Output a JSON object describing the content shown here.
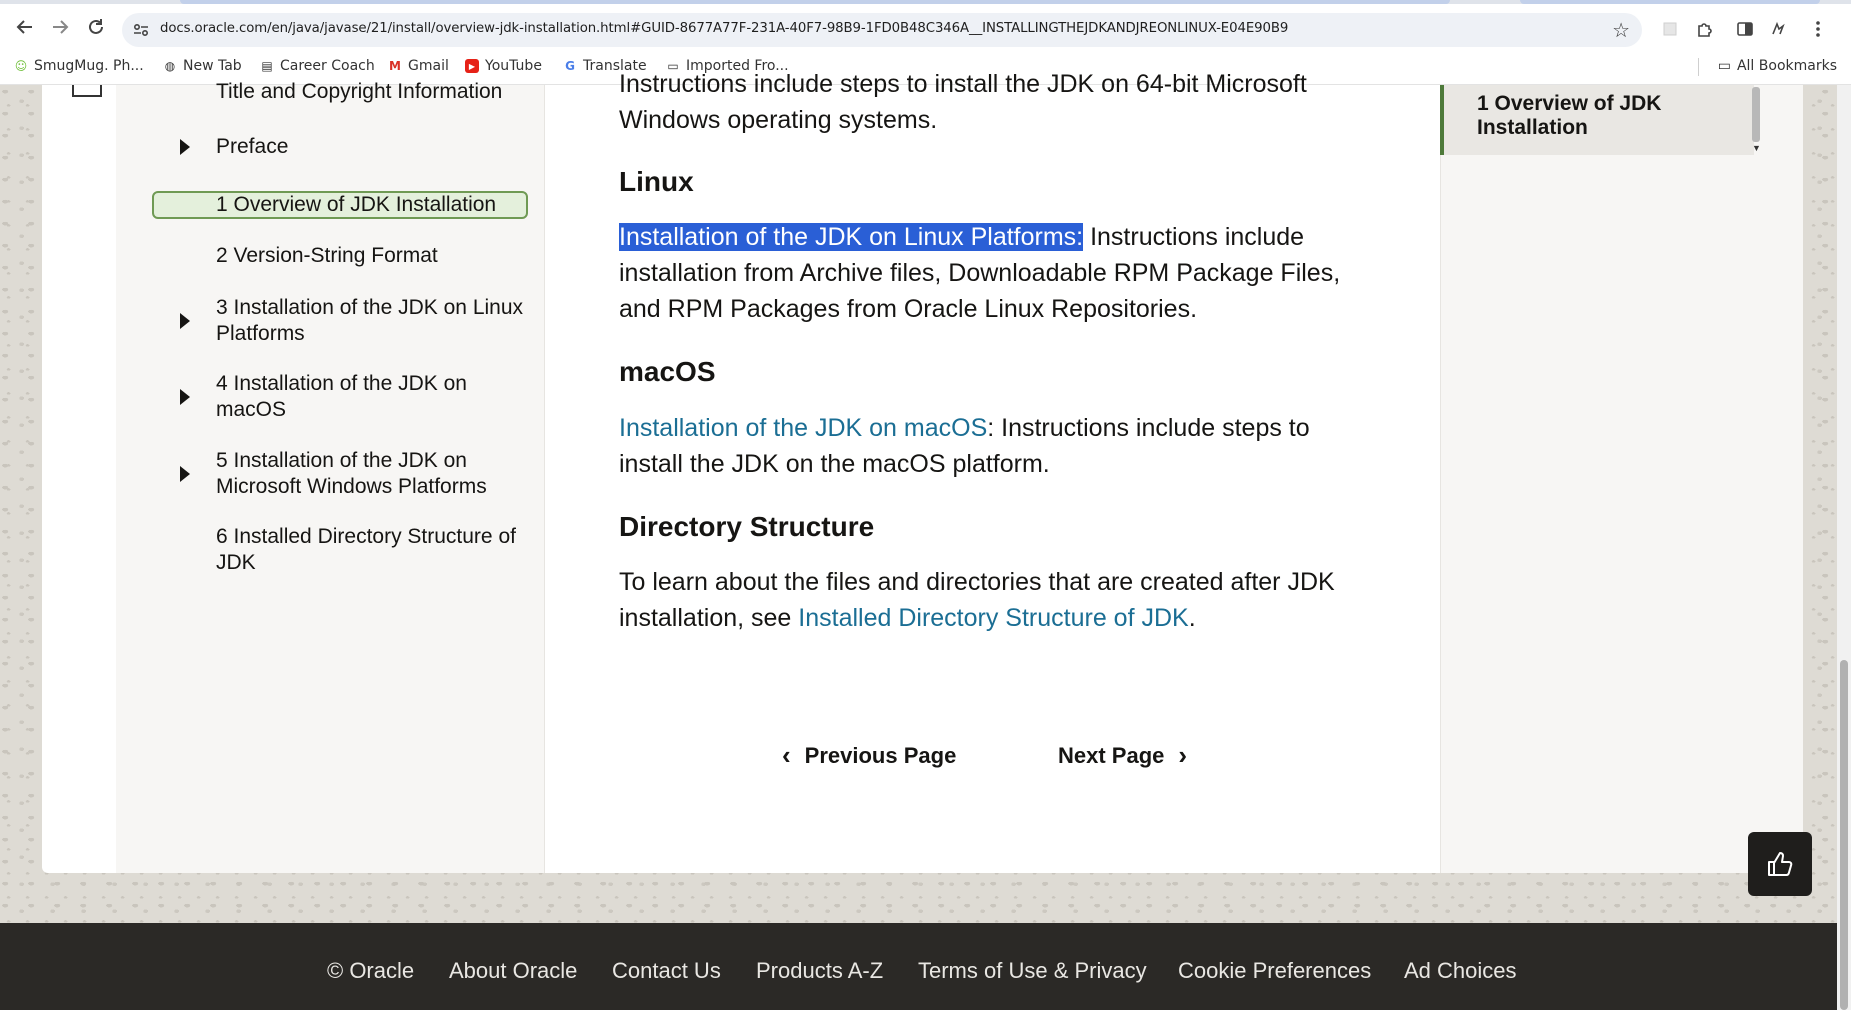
{
  "browser": {
    "url": "docs.oracle.com/en/java/javase/21/install/overview-jdk-installation.html#GUID-8677A77F-231A-40F7-98B9-1FD0B48C346A__INSTALLINGTHEJDKANDJREONLINUX-E04E90B9",
    "bookmarks": [
      {
        "label": "SmugMug. Ph...",
        "icon": "smugmug-icon"
      },
      {
        "label": "New Tab",
        "icon": "globe-icon"
      },
      {
        "label": "Career Coach",
        "icon": "career-coach-icon"
      },
      {
        "label": "Gmail",
        "icon": "gmail-icon"
      },
      {
        "label": "YouTube",
        "icon": "youtube-icon"
      },
      {
        "label": "Translate",
        "icon": "translate-icon"
      },
      {
        "label": "Imported Fro...",
        "icon": "folder-icon"
      }
    ],
    "all_bookmarks": "All Bookmarks"
  },
  "toc": {
    "items": [
      {
        "label": "Title and Copyright Information",
        "expandable": false
      },
      {
        "label": "Preface",
        "expandable": true
      },
      {
        "label": "1 Overview of JDK Installation",
        "expandable": false,
        "active": true
      },
      {
        "label": "2 Version-String Format",
        "expandable": false
      },
      {
        "label": "3 Installation of the JDK on Linux Platforms",
        "expandable": true
      },
      {
        "label": "4 Installation of the JDK on macOS",
        "expandable": true
      },
      {
        "label": "5 Installation of the JDK on Microsoft Windows Platforms",
        "expandable": true
      },
      {
        "label": "6 Installed Directory Structure of JDK",
        "expandable": false
      }
    ]
  },
  "main": {
    "windows_tail_line1": "Instructions include steps to install the JDK on 64-bit Microsoft",
    "windows_tail_line2": "Windows operating systems.",
    "linux": {
      "heading": "Linux",
      "link": "Installation of the JDK on Linux Platforms:",
      "text_line1": " Instructions include",
      "text_line2": "installation from Archive files, Downloadable RPM Package Files,",
      "text_line3": "and RPM Packages from Oracle Linux Repositories."
    },
    "macos": {
      "heading": "macOS",
      "link": "Installation of the JDK on macOS",
      "text_line1": ": Instructions include steps to",
      "text_line2": "install the JDK on the macOS platform."
    },
    "directory": {
      "heading": "Directory Structure",
      "text_line1": "To learn about the files and directories that are created after JDK",
      "text_line2": "installation, see ",
      "link": "Installed Directory Structure of JDK",
      "end": "."
    },
    "prev_label": "Previous Page",
    "next_label": "Next Page"
  },
  "right_panel": {
    "active_item": "1 Overview of JDK Installation"
  },
  "footer": {
    "links": [
      "© Oracle",
      "About Oracle",
      "Contact Us",
      "Products A-Z",
      "Terms of Use & Privacy",
      "Cookie Preferences",
      "Ad Choices"
    ]
  },
  "colors": {
    "link": "#1b6e94",
    "selection": "#2a5fd6",
    "active_nav_bg": "#e4f0dc",
    "active_nav_border": "#6f9a54",
    "footer_bg": "#2b2926"
  }
}
